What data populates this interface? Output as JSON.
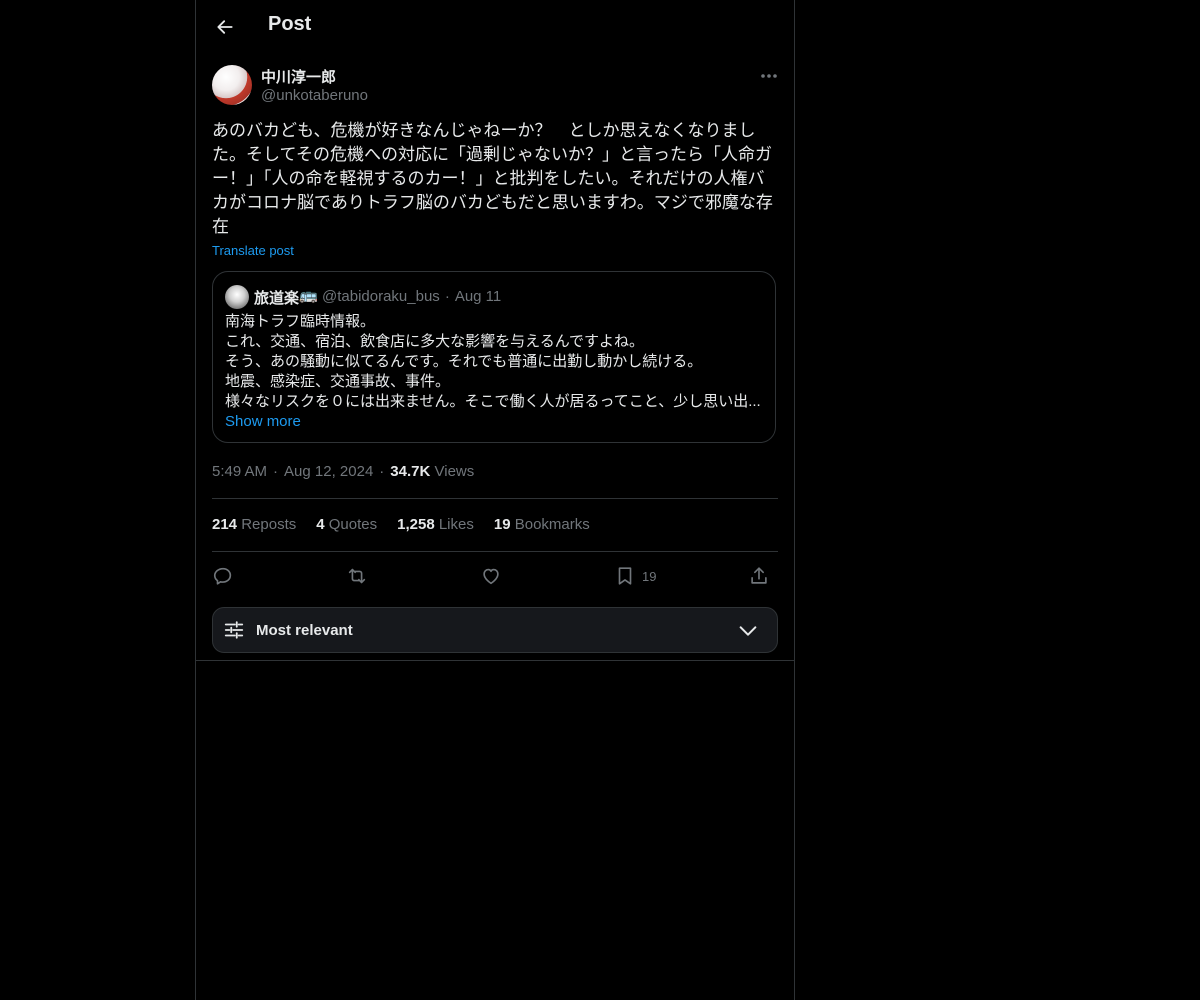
{
  "header": {
    "title": "Post"
  },
  "post": {
    "author_name": "中川淳一郎",
    "author_handle": "@unkotaberuno",
    "text": "あのバカども、危機が好きなんじゃねーか？　としか思えなくなりました。そしてその危機への対応に「過剰じゃないか？」と言ったら「人命ガー！」「人の命を軽視するのカー！」と批判をしたい。それだけの人権バカがコロナ脳でありトラフ脳のバカどもだと思いますわ。マジで邪魔な存在",
    "translate_label": "Translate post",
    "time": "5:49 AM",
    "date": "Aug 12, 2024",
    "views_count": "34.7K",
    "views_label": "Views"
  },
  "quote": {
    "author_name": "旅道楽",
    "badge": "🚌",
    "author_handle": "@tabidoraku_bus",
    "date": "Aug 11",
    "lines": [
      "南海トラフ臨時情報。",
      "これ、交通、宿泊、飲食店に多大な影響を与えるんですよね。",
      "そう、あの騒動に似てるんです。それでも普通に出勤し動かし続ける。",
      "地震、感染症、交通事故、事件。",
      "様々なリスクを０には出来ません。そこで働く人が居るってこと、少し思い出..."
    ],
    "show_more": "Show more"
  },
  "stats": {
    "reposts_count": "214",
    "reposts_label": "Reposts",
    "quotes_count": "4",
    "quotes_label": "Quotes",
    "likes_count": "1,258",
    "likes_label": "Likes",
    "bookmarks_count": "19",
    "bookmarks_label": "Bookmarks"
  },
  "actions": {
    "bookmark_count": "19"
  },
  "sort": {
    "label": "Most relevant"
  },
  "icons": {
    "back": "arrow-left-icon",
    "more": "more-horizontal-icon",
    "reply": "reply-icon",
    "repost": "repost-icon",
    "like": "heart-icon",
    "bookmark": "bookmark-icon",
    "share": "share-icon",
    "sort": "sliders-icon",
    "chevron": "chevron-down-icon"
  },
  "colors": {
    "background": "#000000",
    "text": "#e7e9ea",
    "muted": "#71767b",
    "link": "#1d9bf0",
    "border": "#2f3336"
  }
}
